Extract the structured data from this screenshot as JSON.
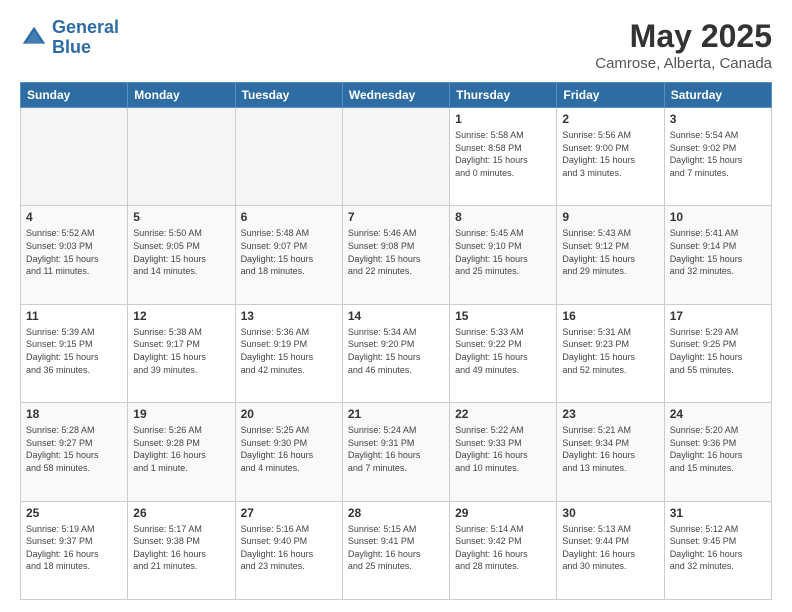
{
  "logo": {
    "line1": "General",
    "line2": "Blue"
  },
  "title": "May 2025",
  "subtitle": "Camrose, Alberta, Canada",
  "days_of_week": [
    "Sunday",
    "Monday",
    "Tuesday",
    "Wednesday",
    "Thursday",
    "Friday",
    "Saturday"
  ],
  "weeks": [
    [
      {
        "day": "",
        "empty": true
      },
      {
        "day": "",
        "empty": true
      },
      {
        "day": "",
        "empty": true
      },
      {
        "day": "",
        "empty": true
      },
      {
        "day": "1",
        "info": "Sunrise: 5:58 AM\nSunset: 8:58 PM\nDaylight: 15 hours\nand 0 minutes."
      },
      {
        "day": "2",
        "info": "Sunrise: 5:56 AM\nSunset: 9:00 PM\nDaylight: 15 hours\nand 3 minutes."
      },
      {
        "day": "3",
        "info": "Sunrise: 5:54 AM\nSunset: 9:02 PM\nDaylight: 15 hours\nand 7 minutes."
      }
    ],
    [
      {
        "day": "4",
        "info": "Sunrise: 5:52 AM\nSunset: 9:03 PM\nDaylight: 15 hours\nand 11 minutes."
      },
      {
        "day": "5",
        "info": "Sunrise: 5:50 AM\nSunset: 9:05 PM\nDaylight: 15 hours\nand 14 minutes."
      },
      {
        "day": "6",
        "info": "Sunrise: 5:48 AM\nSunset: 9:07 PM\nDaylight: 15 hours\nand 18 minutes."
      },
      {
        "day": "7",
        "info": "Sunrise: 5:46 AM\nSunset: 9:08 PM\nDaylight: 15 hours\nand 22 minutes."
      },
      {
        "day": "8",
        "info": "Sunrise: 5:45 AM\nSunset: 9:10 PM\nDaylight: 15 hours\nand 25 minutes."
      },
      {
        "day": "9",
        "info": "Sunrise: 5:43 AM\nSunset: 9:12 PM\nDaylight: 15 hours\nand 29 minutes."
      },
      {
        "day": "10",
        "info": "Sunrise: 5:41 AM\nSunset: 9:14 PM\nDaylight: 15 hours\nand 32 minutes."
      }
    ],
    [
      {
        "day": "11",
        "info": "Sunrise: 5:39 AM\nSunset: 9:15 PM\nDaylight: 15 hours\nand 36 minutes."
      },
      {
        "day": "12",
        "info": "Sunrise: 5:38 AM\nSunset: 9:17 PM\nDaylight: 15 hours\nand 39 minutes."
      },
      {
        "day": "13",
        "info": "Sunrise: 5:36 AM\nSunset: 9:19 PM\nDaylight: 15 hours\nand 42 minutes."
      },
      {
        "day": "14",
        "info": "Sunrise: 5:34 AM\nSunset: 9:20 PM\nDaylight: 15 hours\nand 46 minutes."
      },
      {
        "day": "15",
        "info": "Sunrise: 5:33 AM\nSunset: 9:22 PM\nDaylight: 15 hours\nand 49 minutes."
      },
      {
        "day": "16",
        "info": "Sunrise: 5:31 AM\nSunset: 9:23 PM\nDaylight: 15 hours\nand 52 minutes."
      },
      {
        "day": "17",
        "info": "Sunrise: 5:29 AM\nSunset: 9:25 PM\nDaylight: 15 hours\nand 55 minutes."
      }
    ],
    [
      {
        "day": "18",
        "info": "Sunrise: 5:28 AM\nSunset: 9:27 PM\nDaylight: 15 hours\nand 58 minutes."
      },
      {
        "day": "19",
        "info": "Sunrise: 5:26 AM\nSunset: 9:28 PM\nDaylight: 16 hours\nand 1 minute."
      },
      {
        "day": "20",
        "info": "Sunrise: 5:25 AM\nSunset: 9:30 PM\nDaylight: 16 hours\nand 4 minutes."
      },
      {
        "day": "21",
        "info": "Sunrise: 5:24 AM\nSunset: 9:31 PM\nDaylight: 16 hours\nand 7 minutes."
      },
      {
        "day": "22",
        "info": "Sunrise: 5:22 AM\nSunset: 9:33 PM\nDaylight: 16 hours\nand 10 minutes."
      },
      {
        "day": "23",
        "info": "Sunrise: 5:21 AM\nSunset: 9:34 PM\nDaylight: 16 hours\nand 13 minutes."
      },
      {
        "day": "24",
        "info": "Sunrise: 5:20 AM\nSunset: 9:36 PM\nDaylight: 16 hours\nand 15 minutes."
      }
    ],
    [
      {
        "day": "25",
        "info": "Sunrise: 5:19 AM\nSunset: 9:37 PM\nDaylight: 16 hours\nand 18 minutes."
      },
      {
        "day": "26",
        "info": "Sunrise: 5:17 AM\nSunset: 9:38 PM\nDaylight: 16 hours\nand 21 minutes."
      },
      {
        "day": "27",
        "info": "Sunrise: 5:16 AM\nSunset: 9:40 PM\nDaylight: 16 hours\nand 23 minutes."
      },
      {
        "day": "28",
        "info": "Sunrise: 5:15 AM\nSunset: 9:41 PM\nDaylight: 16 hours\nand 25 minutes."
      },
      {
        "day": "29",
        "info": "Sunrise: 5:14 AM\nSunset: 9:42 PM\nDaylight: 16 hours\nand 28 minutes."
      },
      {
        "day": "30",
        "info": "Sunrise: 5:13 AM\nSunset: 9:44 PM\nDaylight: 16 hours\nand 30 minutes."
      },
      {
        "day": "31",
        "info": "Sunrise: 5:12 AM\nSunset: 9:45 PM\nDaylight: 16 hours\nand 32 minutes."
      }
    ]
  ]
}
